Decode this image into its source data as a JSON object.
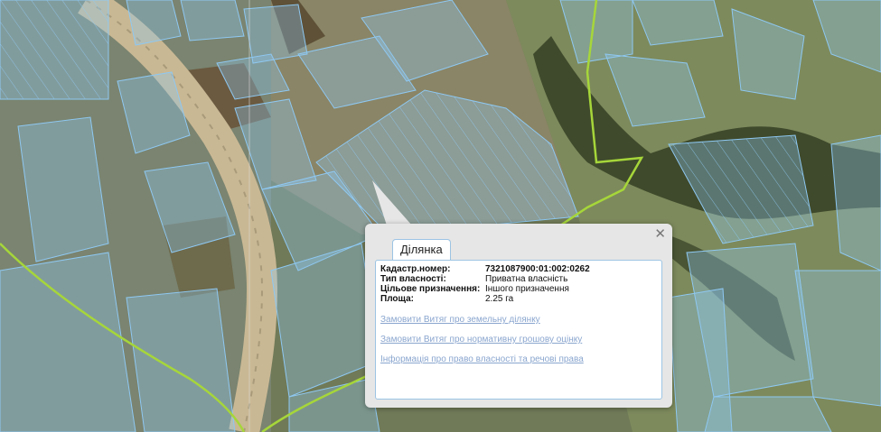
{
  "popup": {
    "tab_label": "Ділянка",
    "close_glyph": "✕",
    "fields": [
      {
        "label": "Кадастр.номер:",
        "value": "7321087900:01:002:0262"
      },
      {
        "label": "Тип власності:",
        "value": "Приватна власність"
      },
      {
        "label": "Цільове призначення:",
        "value": "Іншого призначення"
      },
      {
        "label": "Площа:",
        "value": "2.25 га"
      }
    ],
    "links": [
      "Замовити Витяг про земельну ділянку",
      "Замовити Витяг про нормативну грошову оцінку",
      "Інформація про право власності та речові права"
    ]
  },
  "map": {
    "parcel_color": "#8ec8f2",
    "boundary_color": "#a6d63a",
    "road_color": "#c9b894"
  }
}
